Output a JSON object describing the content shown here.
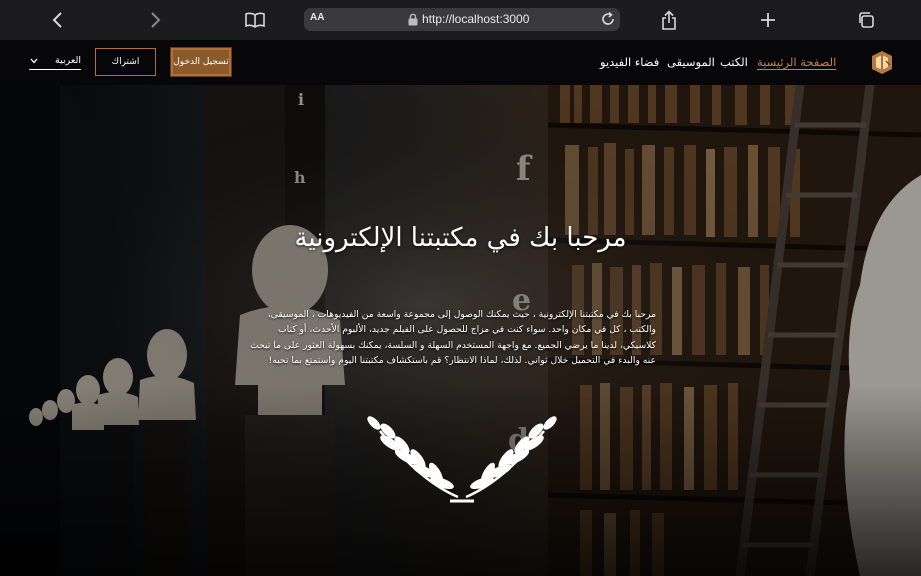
{
  "browser": {
    "aa_label": "AA",
    "url": "http://localhost:3000",
    "icons": {
      "back": "chevron-left-icon",
      "forward": "chevron-right-icon",
      "bookmarks": "book-icon",
      "lock": "lock-icon",
      "reload": "reload-icon",
      "share": "share-icon",
      "new_tab": "plus-icon",
      "tabs": "tabs-icon"
    }
  },
  "navbar": {
    "links": [
      {
        "label": "الصفحة الرئيسية",
        "active": true
      },
      {
        "label": "الكتب",
        "active": false
      },
      {
        "label": "الموسيقى",
        "active": false
      },
      {
        "label": "فضاء الفيديو",
        "active": false
      }
    ],
    "login_label": "تسجيل الدخول",
    "subscribe_label": "اشتراك",
    "language_label": "العربية",
    "logo_icon": "book-logo-icon",
    "accent_color": "#c8843c"
  },
  "hero": {
    "title": "مرحبا بك في مكتبتنا الإلكترونية",
    "description": "مرحبا بك في مكتبتنا الإلكترونية ، حيث يمكنك الوصول إلى مجموعة واسعة من الفيديوهات ، الموسيقى، والكتب ، كل في مكان واحد. سواء كنت في مزاج للحصول على الفيلم جديد، الألبوم الأحدث، أو كتاب كلاسيكي، لدينا ما يرضي الجميع. مع واجهة المستخدم السهلة و السلسة، يمكنك بسهولة العثور على ما تبحث عنه والبدء في التحميل خلال ثواني. لذلك، لماذا الانتظار؟ قم باستكشاف مكتبتنا اليوم واستمتع بما تحبه!",
    "decoration_icon": "laurel-wreath-icon"
  }
}
